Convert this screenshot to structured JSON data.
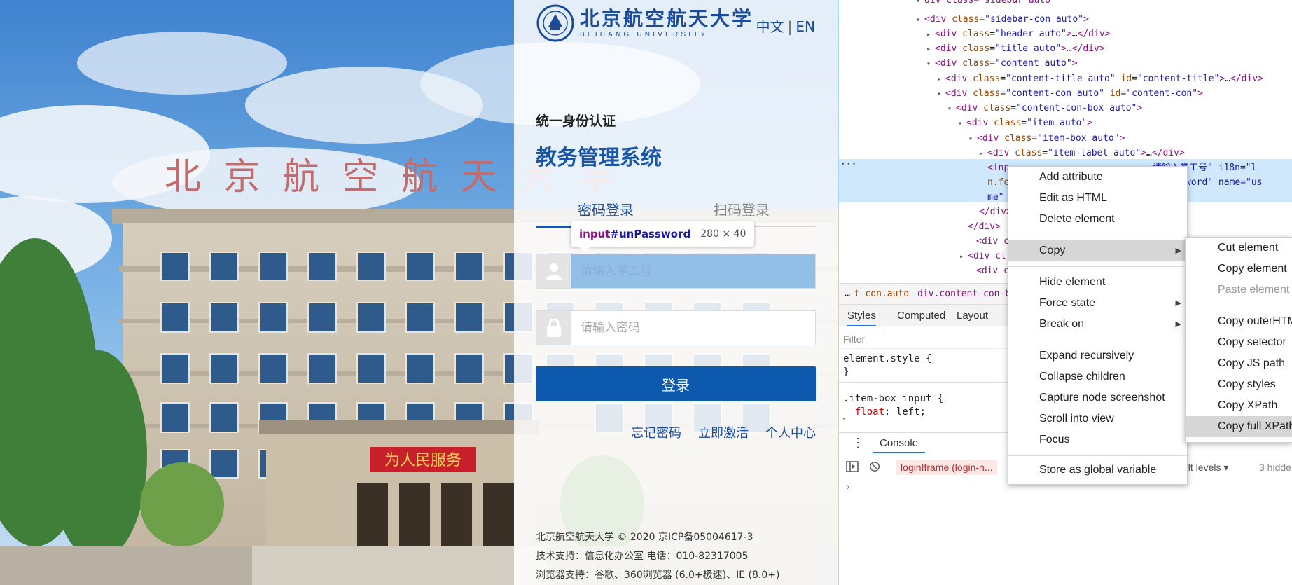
{
  "login": {
    "logo_cn": "北京航空航天大学",
    "logo_en": "BEIHANG UNIVERSITY",
    "lang_zh": "中文",
    "lang_sep": "|",
    "lang_en": "EN",
    "subtitle": "统一身份认证",
    "system_title": "教务管理系统",
    "tab_password": "密码登录",
    "tab_qrcode": "扫码登录",
    "tooltip_tag": "input",
    "tooltip_id": "#unPassword",
    "tooltip_size": "280 × 40",
    "username_placeholder": "请输入学工号",
    "password_placeholder": "请输入密码",
    "login_button": "登录",
    "link_forgot": "忘记密码",
    "link_activate": "立即激活",
    "link_personal": "个人中心",
    "footer_1": "北京航空航天大学 © 2020 京ICP备05004617-3",
    "footer_2": "技术支持：信息化办公室 电话：010-82317005",
    "footer_3": "浏览器支持：谷歌、360浏览器 (6.0+极速)、IE (8.0+)"
  },
  "photo": {
    "roof_sign": "北 京 航 空 航 天 大 学",
    "entrance_banner": "为人民服务"
  },
  "devtools": {
    "crumb_1": "t-con.auto",
    "crumb_2": "div.content-con-bo",
    "tab_styles": "Styles",
    "tab_computed": "Computed",
    "tab_layout": "Layout",
    "filter_placeholder": "Filter",
    "rule_1": "element.style {",
    "rule_1_end": "}",
    "rule_2": ".item-box input {",
    "rule_2_prop": "float",
    "rule_2_val": "left;",
    "console_tab": "Console",
    "console_context": "loginIframe (login-n...",
    "console_levels": "ult levels ▾",
    "console_hidden": "3 hidde",
    "dom": {
      "l0": "div class=\"sidebar auto\"",
      "l1_tag": "div",
      "l1_cls": "sidebar-con auto",
      "l2_tag": "div",
      "l2_cls": "header auto",
      "l3_tag": "div",
      "l3_cls": "title auto",
      "l4_tag": "div",
      "l4_cls": "content auto",
      "l5_cls": "content-title auto",
      "l5_id": "content-title",
      "l6_cls": "content-con auto",
      "l6_id": "content-con",
      "l7_cls": "content-con-box auto",
      "l8_cls": "item auto",
      "l9_cls": "item-box auto",
      "l10_cls": "item-label auto",
      "sel_a": "<inp",
      "sel_b": "请输入学工号\" i18n=\"l",
      "sel_c": "n.fo",
      "sel_d": "unPassword\" name=\"us",
      "sel_e": "me\"",
      "close_div": "</div>",
      "div_cl": "<div cl"
    }
  },
  "context_menu": {
    "items": [
      "Add attribute",
      "Edit as HTML",
      "Delete element",
      "Copy",
      "Hide element",
      "Force state",
      "Break on",
      "Expand recursively",
      "Collapse children",
      "Capture node screenshot",
      "Scroll into view",
      "Focus",
      "Store as global variable"
    ]
  },
  "copy_submenu": {
    "items": [
      "Cut element",
      "Copy element",
      "Paste element",
      "Copy outerHTM",
      "Copy selector",
      "Copy JS path",
      "Copy styles",
      "Copy XPath",
      "Copy full XPath"
    ]
  }
}
